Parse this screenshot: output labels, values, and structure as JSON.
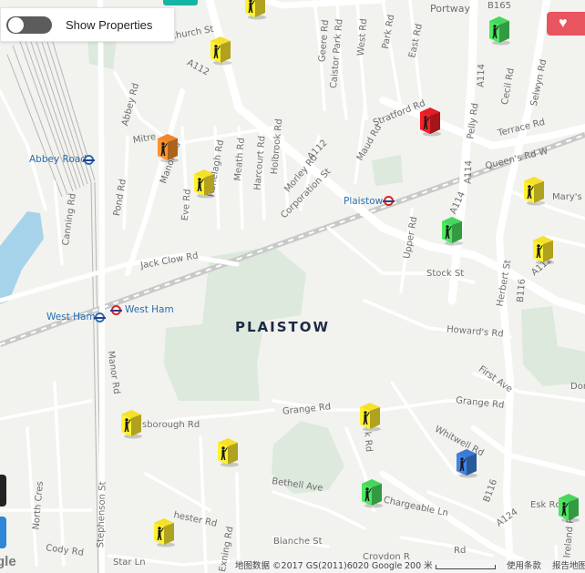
{
  "controls": {
    "toggle_label": "Show Properties",
    "toggle_state": "off",
    "favourite_icon": "heart-icon",
    "accent_color": "#15b5a4",
    "favourite_color": "#e8555f"
  },
  "map": {
    "area_label": "PLAISTOW",
    "stations": {
      "abbey_road": "Abbey Road",
      "west_ham_1": "West Ham",
      "west_ham_2": "West Ham",
      "plaistow": "Plaistow"
    },
    "street_labels": {
      "portway": "Portway",
      "b165": "B165",
      "church_st": "Church St",
      "a112_top": "A112",
      "a112_mid": "A112",
      "a112_right": "A112",
      "geere_rd": "Geere Rd",
      "caistor_park_rd": "Caistor Park Rd",
      "west_rd": "West Rd",
      "park_rd": "Park Rd",
      "east_rd": "East Rd",
      "a114_top": "A114",
      "a114_mid": "A114",
      "a114_lower": "A114",
      "cecil_rd": "Cecil Rd",
      "selwyn_rd": "Selwyn Rd",
      "terrace_rd": "Terrace Rd",
      "queens_rd_w": "Queen's Rd W",
      "marys_rd": "Mary's R",
      "abbey_rd": "Abbey Rd",
      "mitre": "Mitre",
      "ranelagh_rd": "Ranelagh Rd",
      "meath_rd": "Meath Rd",
      "harcourt_rd": "Harcourt Rd",
      "holbrook_rd": "Holbrook Rd",
      "stratford_rd": "Stratford Rd",
      "pelly_rd": "Pelly Rd",
      "manor_rd_top": "Manor Rd",
      "manor_rd_lower": "Manor Rd",
      "eve_rd": "Eve Rd",
      "pond_rd": "Pond Rd",
      "morley_rd": "Morley Rd",
      "corporation_st": "Corporation St",
      "maud_rd": "Maud Rd",
      "canning_rd": "Canning Rd",
      "upper_rd": "Upper Rd",
      "jack_clow_rd": "Jack Clow Rd",
      "stock_st": "Stock St",
      "herbert_st": "Herbert St",
      "b116_mid": "B116",
      "b116_lower": "B116",
      "howards_rd": "Howard's Rd",
      "first_ave": "First Ave",
      "dongola": "Don",
      "grange_rd_left": "Grange Rd",
      "grange_rd_right": "Grange Rd",
      "borough_rd": "sborough Rd",
      "whitwell_rd": "Whitwell Rd",
      "k_rd": "k Rd",
      "bethell_ave": "Bethell Ave",
      "chargeable_ln": "Chargeable Ln",
      "a124": "A124",
      "esk_rd": "Esk Rd",
      "north_cres": "North Cres",
      "stephenson_st": "Stephenson St",
      "chester_rd": "hester Rd",
      "exning_rd": "Exning Rd",
      "blanche_st": "Blanche St",
      "cody_rd": "Cody Rd",
      "star_ln": "Star Ln",
      "croydon_rd": "Croydon R",
      "rd": "Rd",
      "ireland_rd": "Ireland Rd"
    },
    "attribution": {
      "map_data": "地图数据 ©2017 GS(2011)6020 Google",
      "scale": "200 米",
      "terms": "使用条款",
      "report": "报告地图"
    },
    "google_logo": "gle"
  },
  "markers": [
    {
      "id": "m1",
      "color": "#f5e02a",
      "icon": "person-icon"
    },
    {
      "id": "m2",
      "color": "#f5e02a",
      "icon": "person-icon"
    },
    {
      "id": "m3",
      "color": "#47d65b",
      "icon": "person-icon"
    },
    {
      "id": "m4",
      "color": "#e51d24",
      "icon": "person-icon"
    },
    {
      "id": "m5",
      "color": "#f0872a",
      "icon": "person-icon"
    },
    {
      "id": "m6",
      "color": "#f5e02a",
      "icon": "person-icon"
    },
    {
      "id": "m7",
      "color": "#f5e02a",
      "icon": "person-icon"
    },
    {
      "id": "m8",
      "color": "#47d65b",
      "icon": "person-icon"
    },
    {
      "id": "m9",
      "color": "#f5e02a",
      "icon": "person-icon"
    },
    {
      "id": "m10",
      "color": "#f5e02a",
      "icon": "person-icon"
    },
    {
      "id": "m11",
      "color": "#f5e02a",
      "icon": "person-icon"
    },
    {
      "id": "m12",
      "color": "#f5e02a",
      "icon": "person-icon"
    },
    {
      "id": "m13",
      "color": "#3a7bd5",
      "icon": "person-icon"
    },
    {
      "id": "m14",
      "color": "#47d65b",
      "icon": "person-icon"
    },
    {
      "id": "m15",
      "color": "#47d65b",
      "icon": "person-icon"
    },
    {
      "id": "m16",
      "color": "#f5e02a",
      "icon": "person-icon"
    }
  ]
}
